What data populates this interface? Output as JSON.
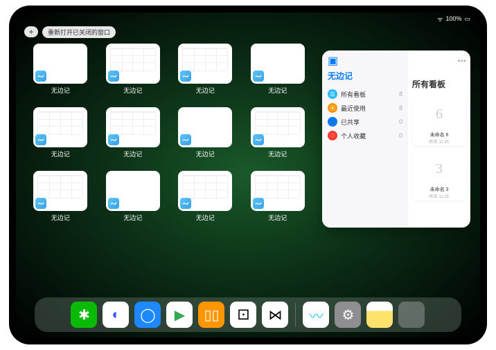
{
  "status": {
    "time": "",
    "right": "100%"
  },
  "topbar": {
    "plus": "+",
    "reopen_label": "重新打开已关闭的窗口"
  },
  "thumbs": [
    {
      "label": "无边记",
      "variant": "blank"
    },
    {
      "label": "无边记",
      "variant": "content"
    },
    {
      "label": "无边记",
      "variant": "content"
    },
    {
      "label": "无边记",
      "variant": "blank"
    },
    {
      "label": "无边记",
      "variant": "content"
    },
    {
      "label": "无边记",
      "variant": "content"
    },
    {
      "label": "无边记",
      "variant": "blank"
    },
    {
      "label": "无边记",
      "variant": "content"
    },
    {
      "label": "无边记",
      "variant": "content"
    },
    {
      "label": "无边记",
      "variant": "blank"
    },
    {
      "label": "无边记",
      "variant": "content"
    },
    {
      "label": "无边记",
      "variant": "content"
    }
  ],
  "panel": {
    "more": "•••",
    "left_title": "无边记",
    "right_title": "所有看板",
    "categories": [
      {
        "label": "所有看板",
        "count": "8",
        "color": "#2dbcff",
        "glyph": "☰"
      },
      {
        "label": "最近使用",
        "count": "8",
        "color": "#ff9500",
        "glyph": "⦿"
      },
      {
        "label": "已共享",
        "count": "0",
        "color": "#007aff",
        "glyph": "👤"
      },
      {
        "label": "个人收藏",
        "count": "0",
        "color": "#ff3b30",
        "glyph": "♡"
      }
    ],
    "boards": [
      {
        "sketch": "6",
        "name": "未命名 6",
        "time": "昨天 11:25"
      },
      {
        "sketch": "3",
        "name": "未命名 3",
        "time": "昨天 11:25"
      }
    ]
  },
  "dock": {
    "left": [
      {
        "name": "wechat-icon",
        "bg": "#09bb07",
        "glyph": "✱"
      },
      {
        "name": "quark-icon",
        "bg": "#ffffff",
        "glyph": "◐",
        "fg": "#3b52ff"
      },
      {
        "name": "qqbrowser-icon",
        "bg": "#1e88ff",
        "glyph": "◯"
      },
      {
        "name": "play-icon",
        "bg": "#ffffff",
        "glyph": "▶",
        "fg": "#34a853"
      },
      {
        "name": "books-icon",
        "bg": "#ff9500",
        "glyph": "▯▯"
      },
      {
        "name": "dice-icon",
        "bg": "#ffffff",
        "glyph": "⚀",
        "fg": "#000"
      },
      {
        "name": "connect-icon",
        "bg": "#ffffff",
        "glyph": "⋈",
        "fg": "#000"
      }
    ],
    "right": [
      {
        "name": "freeform-icon",
        "bg": "#ffffff",
        "glyph": "〰",
        "fg": "#34c3ff"
      },
      {
        "name": "settings-icon",
        "bg": "#8e8e93",
        "glyph": "⚙"
      },
      {
        "name": "notes-icon",
        "bg": "linear-gradient(#fff 35%,#ffe26b 35%)",
        "glyph": "",
        "fg": "#000"
      }
    ]
  }
}
